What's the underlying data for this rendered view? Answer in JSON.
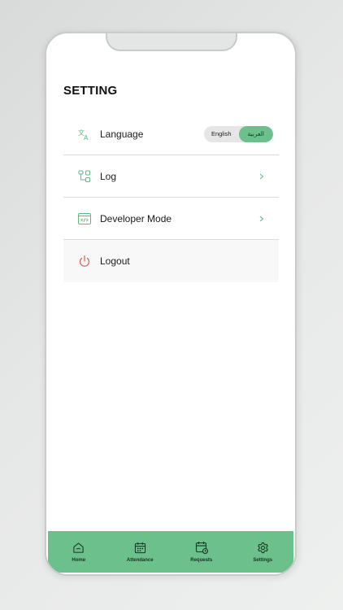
{
  "page": {
    "title": "SETTING"
  },
  "menu": {
    "items": [
      {
        "label": "Language",
        "icon": "translate-icon"
      },
      {
        "label": "Log",
        "icon": "log-icon"
      },
      {
        "label": "Developer Mode",
        "icon": "code-window-icon"
      },
      {
        "label": "Logout",
        "icon": "power-icon"
      }
    ],
    "language_toggle": {
      "options": [
        "English",
        "العربية"
      ],
      "selected": "العربية"
    }
  },
  "tabbar": {
    "items": [
      {
        "label": "Home",
        "icon": "home-icon"
      },
      {
        "label": "Attendance",
        "icon": "calendar-icon"
      },
      {
        "label": "Requests",
        "icon": "calendar-request-icon"
      },
      {
        "label": "Settings",
        "icon": "gear-icon"
      }
    ]
  },
  "colors": {
    "accent": "#6cc08b",
    "logout_icon": "#e05a5a",
    "icon_green": "#5fb982"
  }
}
